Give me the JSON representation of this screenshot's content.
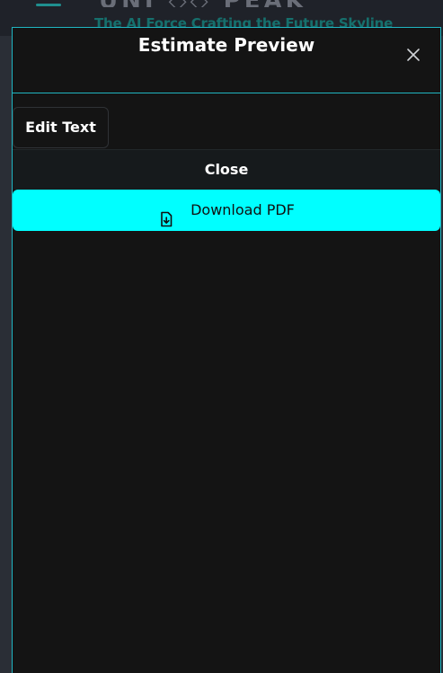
{
  "background": {
    "tagline": "The AI Force Crafting the Future Skyline",
    "logo_text": "UNI ◇◇ PEAK"
  },
  "modal": {
    "title": "Estimate Preview",
    "close_icon": "close-icon"
  },
  "actions": {
    "edit_label": "Edit Text",
    "close_label": "Close",
    "download_label": "Download PDF",
    "download_icon": "file-download-icon"
  },
  "colors": {
    "accent": "#00ffff",
    "border": "#1fb5c2",
    "modal_bg": "#141414"
  }
}
